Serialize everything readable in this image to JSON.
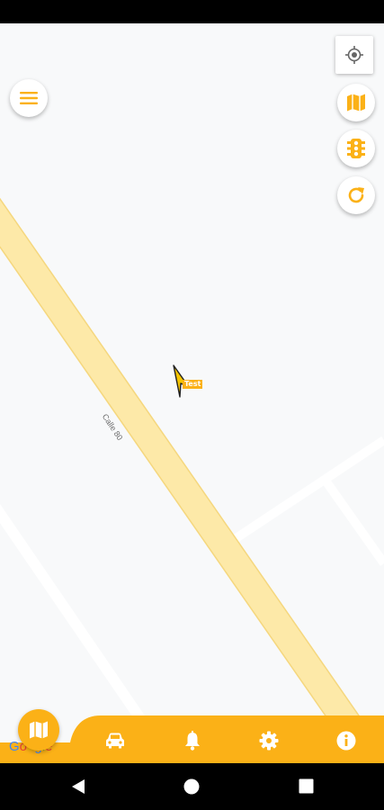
{
  "map": {
    "street_label": "Calle 80",
    "vehicle_tag": "Test",
    "attribution": [
      "G",
      "o",
      "o",
      "g",
      "l",
      "e"
    ],
    "attribution_colors": [
      "#4285F4",
      "#EA4335",
      "#FBBC05",
      "#4285F4",
      "#34A853",
      "#EA4335"
    ]
  },
  "controls": {
    "menu_icon": "hamburger-menu-icon",
    "locate_icon": "my-location-icon",
    "map_type_icon": "map-icon",
    "traffic_icon": "traffic-light-icon",
    "refresh_icon": "refresh-icon"
  },
  "bottom_nav": {
    "items": [
      {
        "icon": "map-icon"
      },
      {
        "icon": "car-icon"
      },
      {
        "icon": "bell-icon"
      },
      {
        "icon": "gear-icon"
      },
      {
        "icon": "info-icon"
      }
    ]
  },
  "colors": {
    "accent": "#FBB117",
    "map_background": "#F8F9FA",
    "road_major": "#FDE9A8",
    "road_major_edge": "#F5D77E",
    "road_minor": "#FFFFFF"
  },
  "android_nav": {
    "items": [
      "back-icon",
      "home-icon",
      "recents-icon"
    ]
  }
}
